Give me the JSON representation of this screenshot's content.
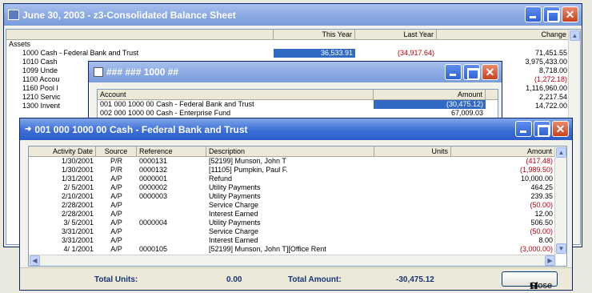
{
  "balance": {
    "title": "June 30, 2003 - z3-Consolidated Balance Sheet",
    "col_this_year": "This Year",
    "col_last_year": "Last Year",
    "col_change": "Change",
    "section": "Assets",
    "rows": [
      {
        "name": "1000 Cash - Federal Bank and Trust",
        "this_year": "36,533.91",
        "last_year": "(34,917.64)",
        "change": "71,451.55"
      },
      {
        "name": "1010 Cash",
        "this_year": "",
        "last_year": "",
        "change": "3,975,433.00"
      },
      {
        "name": "1099 Unde",
        "this_year": "",
        "last_year": "",
        "change": "8,718.00"
      },
      {
        "name": "1100 Accou",
        "this_year": "",
        "last_year": "",
        "change": "(1,272.18)"
      },
      {
        "name": "1160 Pool I",
        "this_year": "",
        "last_year": "",
        "change": "1,116,960.00"
      },
      {
        "name": "1210 Servic",
        "this_year": "",
        "last_year": "",
        "change": "2,217.54"
      },
      {
        "name": "1300 Invent",
        "this_year": "",
        "last_year": "",
        "change": "14,722.00"
      }
    ]
  },
  "accounts": {
    "title": "### ### 1000 ##",
    "col_account": "Account",
    "col_amount": "Amount",
    "rows": [
      {
        "account": "001 000 1000 00  Cash - Federal Bank and Trust",
        "amount": "(30,475.12)"
      },
      {
        "account": "002 000 1000 00  Cash - Enterprise Fund",
        "amount": "67,009.03"
      }
    ]
  },
  "detail": {
    "title": "001 000 1000 00  Cash - Federal Bank and Trust",
    "columns": {
      "date": "Activity Date",
      "source": "Source",
      "reference": "Reference",
      "description": "Description",
      "units": "Units",
      "amount": "Amount"
    },
    "rows": [
      {
        "date": "1/30/2001",
        "source": "P/R",
        "ref": "0000131",
        "desc": "[52199] Munson, John T",
        "units": "",
        "amount": "(417.48)"
      },
      {
        "date": "1/30/2001",
        "source": "P/R",
        "ref": "0000132",
        "desc": "[11105] Pumpkin, Paul F.",
        "units": "",
        "amount": "(1,989.50)"
      },
      {
        "date": "1/31/2001",
        "source": "A/P",
        "ref": "0000001",
        "desc": "Refund",
        "units": "",
        "amount": "10,000.00"
      },
      {
        "date": "2/ 5/2001",
        "source": "A/P",
        "ref": "0000002",
        "desc": "Utility Payments",
        "units": "",
        "amount": "464.25"
      },
      {
        "date": "2/10/2001",
        "source": "A/P",
        "ref": "0000003",
        "desc": "Utility Payments",
        "units": "",
        "amount": "239.35"
      },
      {
        "date": "2/28/2001",
        "source": "A/P",
        "ref": "",
        "desc": "Service Charge",
        "units": "",
        "amount": "(50.00)"
      },
      {
        "date": "2/28/2001",
        "source": "A/P",
        "ref": "",
        "desc": "Interest Earned",
        "units": "",
        "amount": "12.00"
      },
      {
        "date": "3/ 5/2001",
        "source": "A/P",
        "ref": "0000004",
        "desc": "Utility Payments",
        "units": "",
        "amount": "506.50"
      },
      {
        "date": "3/31/2001",
        "source": "A/P",
        "ref": "",
        "desc": "Service Charge",
        "units": "",
        "amount": "(50.00)"
      },
      {
        "date": "3/31/2001",
        "source": "A/P",
        "ref": "",
        "desc": "Interest Earned",
        "units": "",
        "amount": "8.00"
      },
      {
        "date": "4/ 1/2001",
        "source": "A/P",
        "ref": "0000105",
        "desc": "[52199] Munson, John T][Office Rent",
        "units": "",
        "amount": "(3,000.00)"
      }
    ],
    "footer": {
      "units_label": "Total Units:",
      "units_value": "0.00",
      "amount_label": "Total Amount:",
      "amount_value": "-30,475.12",
      "close_label": "Close",
      "close_icon": "H"
    }
  },
  "icons": {
    "minimize": "minimize-icon",
    "maximize": "maximize-icon",
    "close": "close-icon"
  },
  "colors": {
    "titlebar": "#3d6fd6",
    "negative": "#b8000f",
    "selection": "#316ac5",
    "footer_text": "#16337a"
  }
}
